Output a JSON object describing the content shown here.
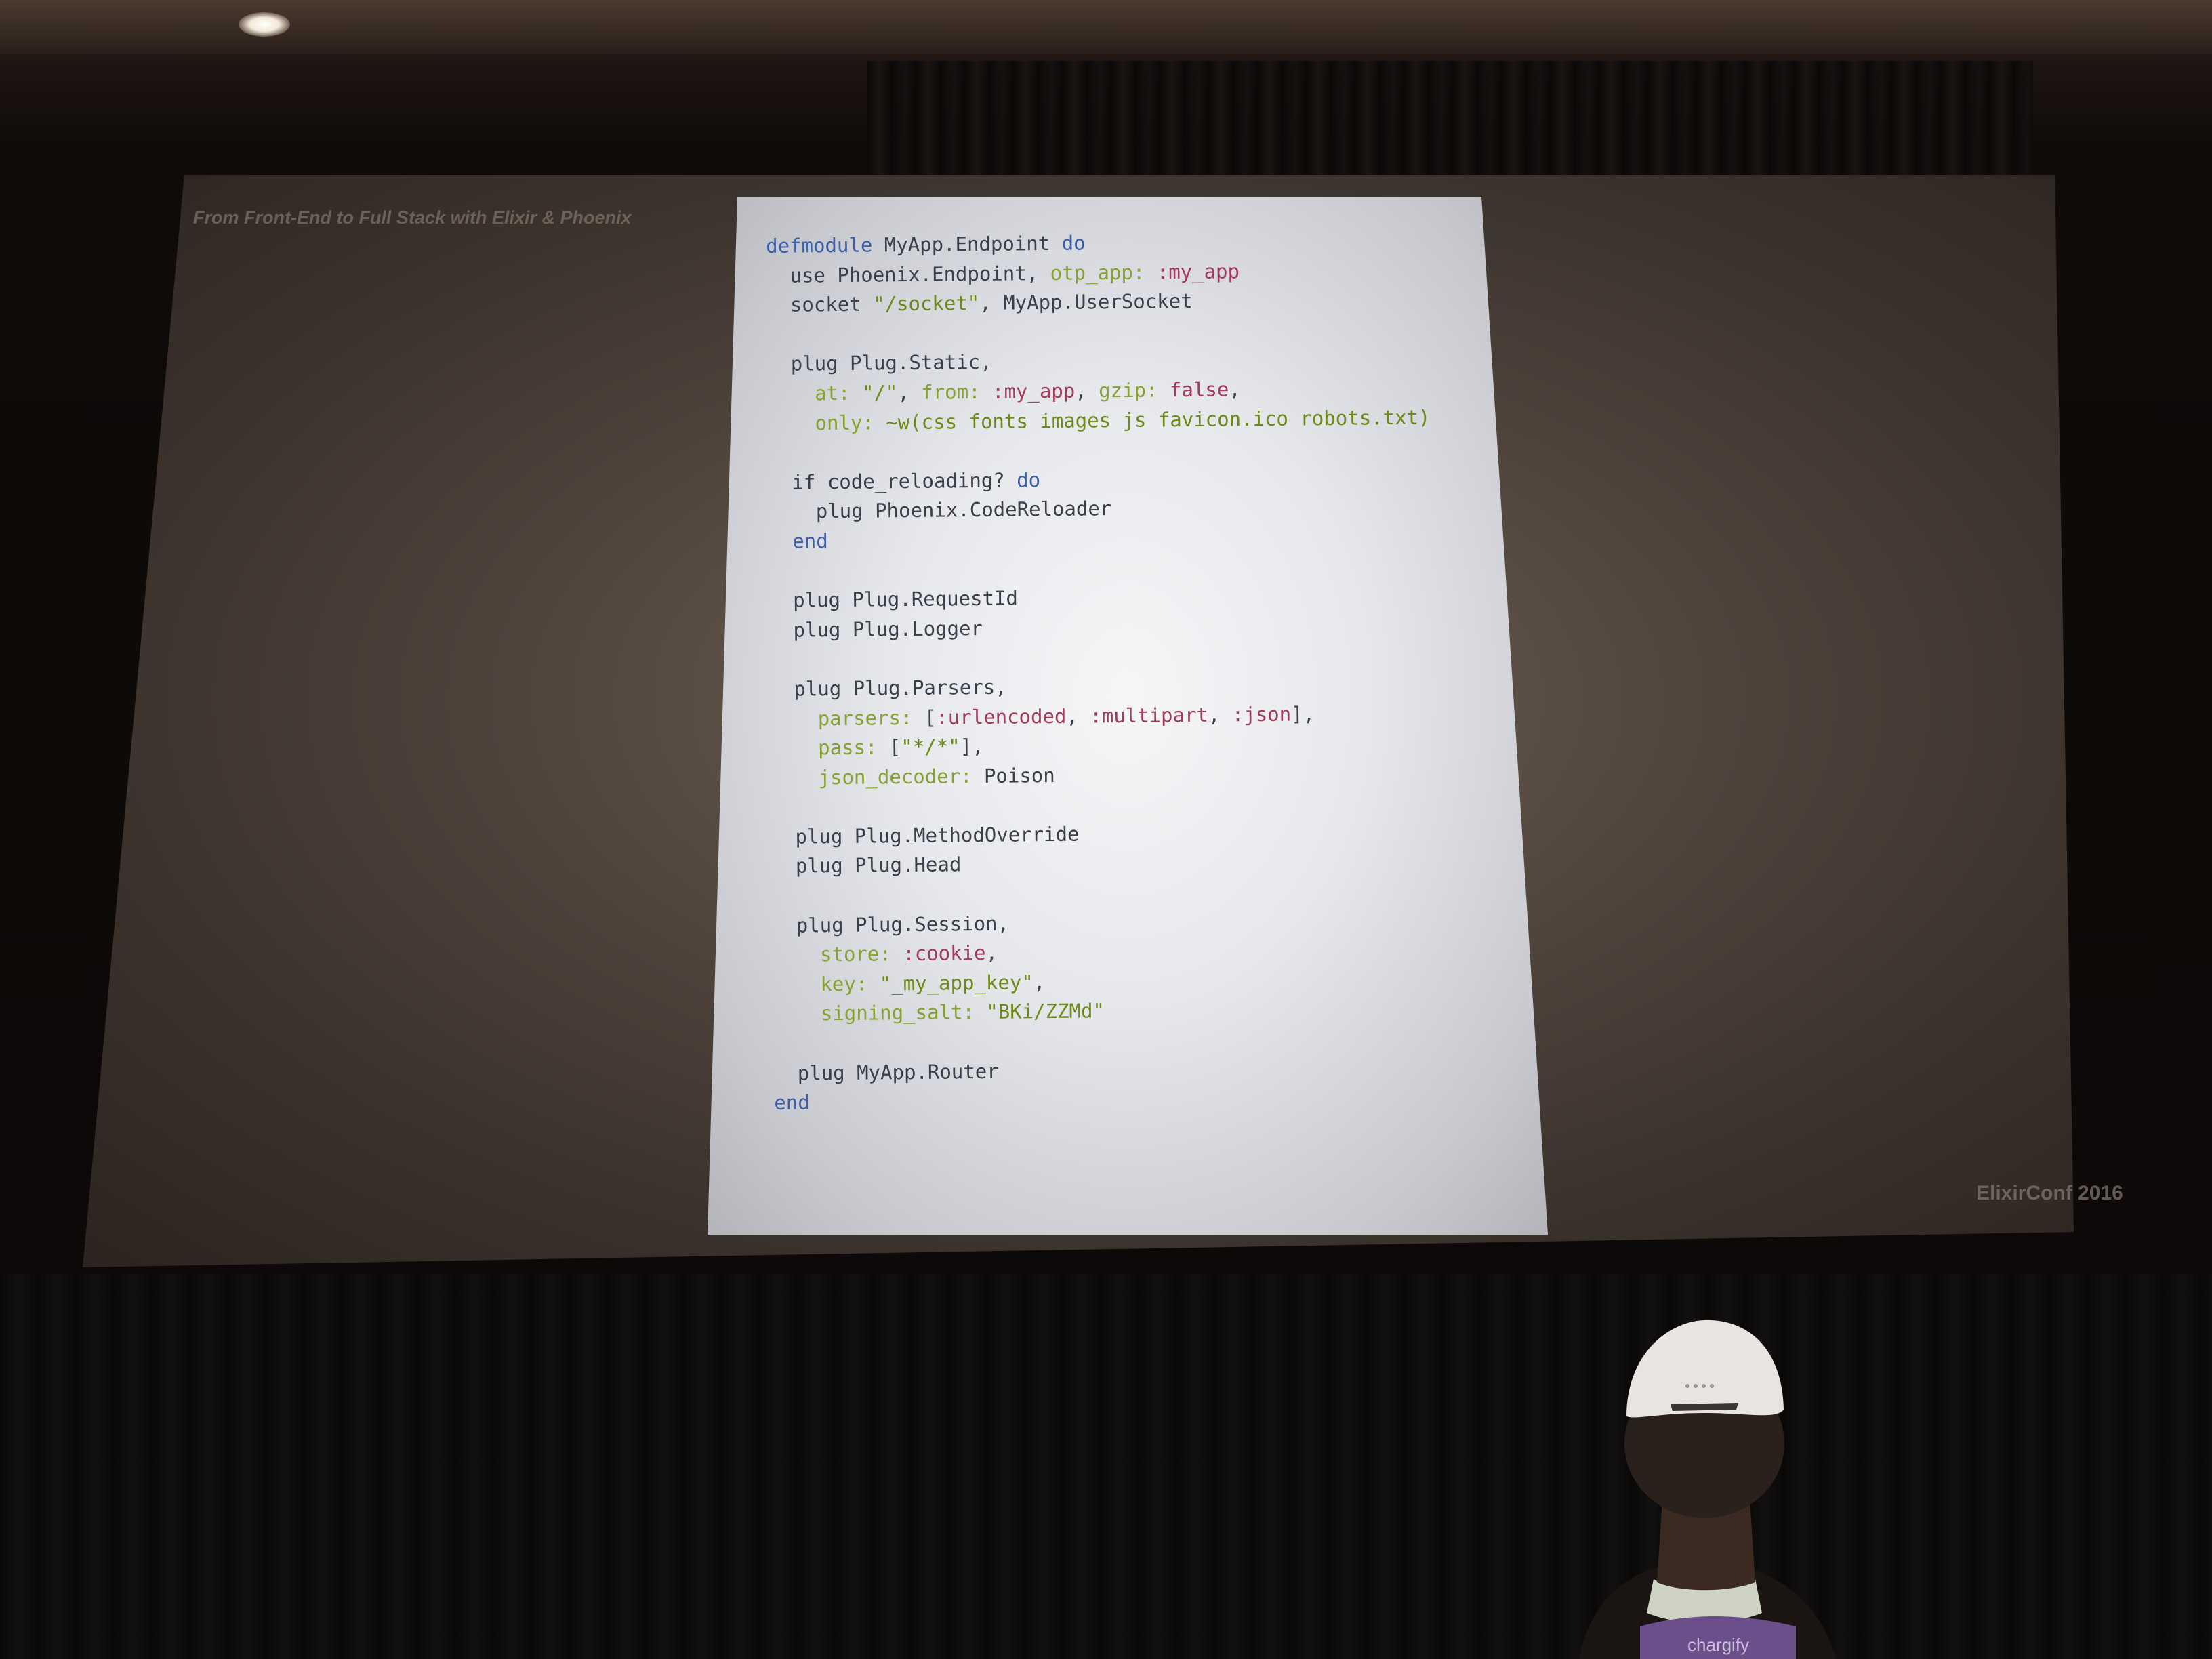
{
  "slide": {
    "title": "From Front-End to Full Stack with Elixir & Phoenix",
    "footer": "ElixirConf 2016"
  },
  "code_lines": [
    [
      [
        "kw",
        "defmodule"
      ],
      [
        "tx",
        " MyApp.Endpoint "
      ],
      [
        "kw",
        "do"
      ]
    ],
    [
      [
        "tx",
        "  use Phoenix.Endpoint, "
      ],
      [
        "opt",
        "otp_app:"
      ],
      [
        "sym",
        " :my_app"
      ]
    ],
    [
      [
        "tx",
        "  socket "
      ],
      [
        "str",
        "\"/socket\""
      ],
      [
        "tx",
        ", MyApp.UserSocket"
      ]
    ],
    [
      [
        "tx",
        ""
      ]
    ],
    [
      [
        "tx",
        "  plug Plug.Static,"
      ]
    ],
    [
      [
        "opt",
        "    at: "
      ],
      [
        "str",
        "\"/\""
      ],
      [
        "tx",
        ", "
      ],
      [
        "opt",
        "from: "
      ],
      [
        "sym",
        ":my_app"
      ],
      [
        "tx",
        ", "
      ],
      [
        "opt",
        "gzip: "
      ],
      [
        "sym",
        "false"
      ],
      [
        "tx",
        ","
      ]
    ],
    [
      [
        "opt",
        "    only: "
      ],
      [
        "str",
        "~w(css fonts images js favicon.ico robots.txt)"
      ]
    ],
    [
      [
        "tx",
        ""
      ]
    ],
    [
      [
        "tx",
        "  if code_reloading? "
      ],
      [
        "kw",
        "do"
      ]
    ],
    [
      [
        "tx",
        "    plug Phoenix.CodeReloader"
      ]
    ],
    [
      [
        "kw",
        "  end"
      ]
    ],
    [
      [
        "tx",
        ""
      ]
    ],
    [
      [
        "tx",
        "  plug Plug.RequestId"
      ]
    ],
    [
      [
        "tx",
        "  plug Plug.Logger"
      ]
    ],
    [
      [
        "tx",
        ""
      ]
    ],
    [
      [
        "tx",
        "  plug Plug.Parsers,"
      ]
    ],
    [
      [
        "opt",
        "    parsers: "
      ],
      [
        "tx",
        "["
      ],
      [
        "sym",
        ":urlencoded"
      ],
      [
        "tx",
        ", "
      ],
      [
        "sym",
        ":multipart"
      ],
      [
        "tx",
        ", "
      ],
      [
        "sym",
        ":json"
      ],
      [
        "tx",
        "],"
      ]
    ],
    [
      [
        "opt",
        "    pass: "
      ],
      [
        "tx",
        "["
      ],
      [
        "str",
        "\"*/*\""
      ],
      [
        "tx",
        "],"
      ]
    ],
    [
      [
        "opt",
        "    json_decoder: "
      ],
      [
        "tx",
        "Poison"
      ]
    ],
    [
      [
        "tx",
        ""
      ]
    ],
    [
      [
        "tx",
        "  plug Plug.MethodOverride"
      ]
    ],
    [
      [
        "tx",
        "  plug Plug.Head"
      ]
    ],
    [
      [
        "tx",
        ""
      ]
    ],
    [
      [
        "tx",
        "  plug Plug.Session,"
      ]
    ],
    [
      [
        "opt",
        "    store: "
      ],
      [
        "sym",
        ":cookie"
      ],
      [
        "tx",
        ","
      ]
    ],
    [
      [
        "opt",
        "    key: "
      ],
      [
        "str",
        "\"_my_app_key\""
      ],
      [
        "tx",
        ","
      ]
    ],
    [
      [
        "opt",
        "    signing_salt: "
      ],
      [
        "str",
        "\"BKi/ZZMd\""
      ]
    ],
    [
      [
        "tx",
        ""
      ]
    ],
    [
      [
        "tx",
        "  plug MyApp.Router"
      ]
    ],
    [
      [
        "kw",
        "end"
      ]
    ]
  ],
  "lanyard": {
    "text": "chargify"
  }
}
